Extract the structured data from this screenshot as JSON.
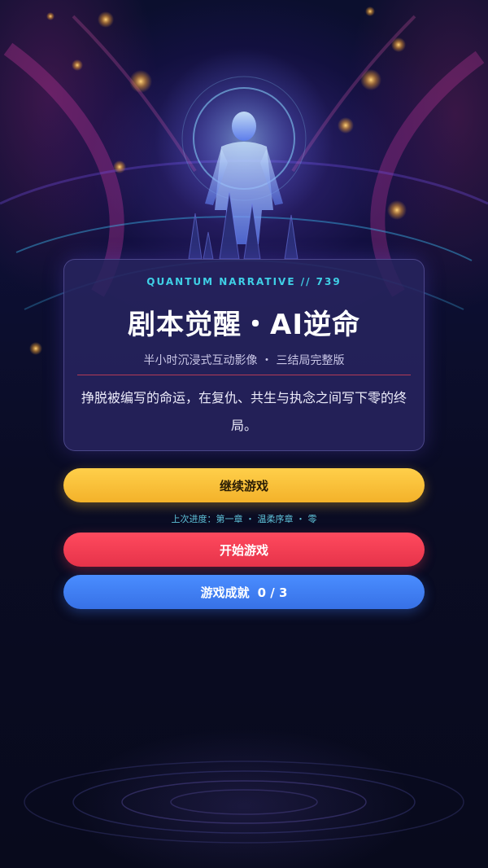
{
  "hero": {
    "eyebrow": "QUANTUM NARRATIVE // 739",
    "title": "剧本觉醒・AI逆命",
    "subtitle": "半小时沉浸式互动影像 ・ 三结局完整版",
    "description": "挣脱被编写的命运，在复仇、共生与执念之间写下零的终局。"
  },
  "actions": {
    "continue_label": "继续游戏",
    "progress_text": "上次进度：第一章 ・ 温柔序章 ・ 零",
    "start_label": "开始游戏",
    "achievements_label": "游戏成就",
    "achievements_count": "0 / 3"
  },
  "colors": {
    "accent_cyan": "#3fd0e6",
    "continue_yellow": "#f8c23a",
    "start_red": "#f23f55",
    "achievements_blue": "#3f7ef2",
    "divider_red": "#b33a55"
  },
  "icons": {
    "background_art": "cosmic-ai-figure-artwork"
  }
}
